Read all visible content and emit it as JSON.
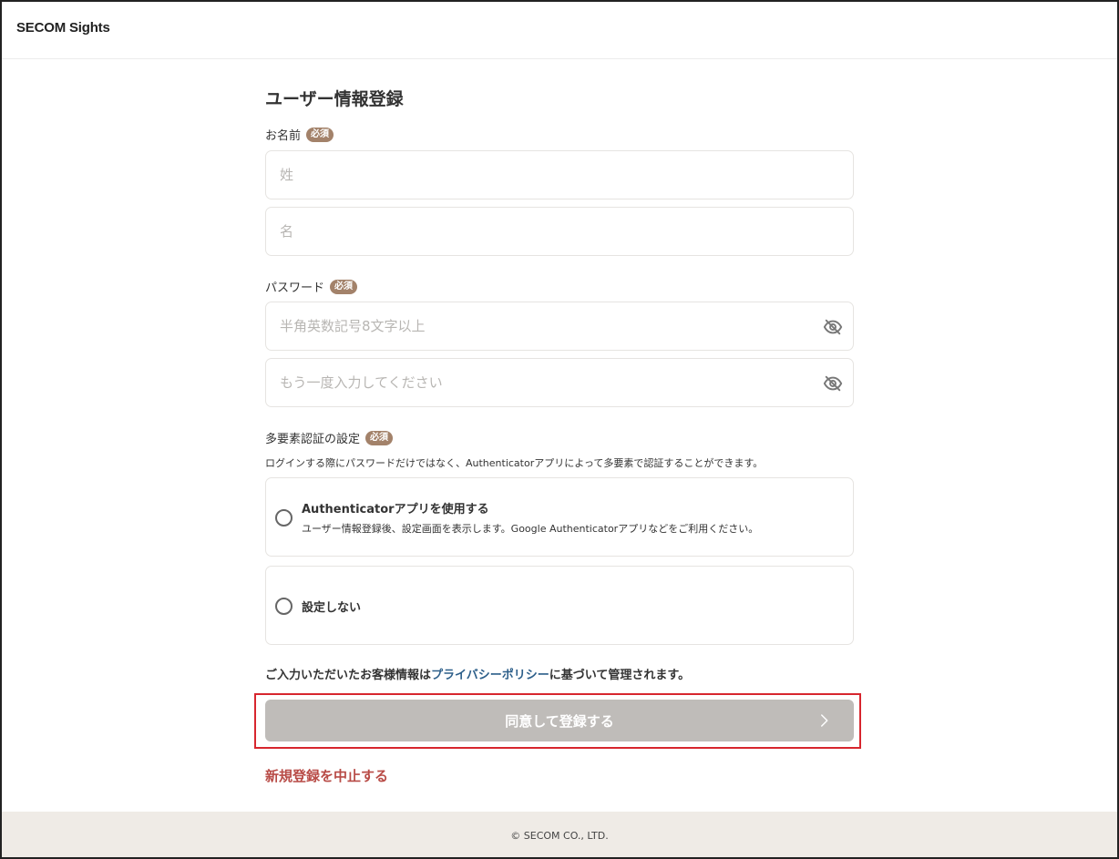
{
  "header": {
    "logo": "SECOM Sights"
  },
  "page": {
    "title": "ユーザー情報登録"
  },
  "required_badge": "必須",
  "name_section": {
    "label": "お名前",
    "last_name_placeholder": "姓",
    "first_name_placeholder": "名"
  },
  "password_section": {
    "label": "パスワード",
    "password_placeholder": "半角英数記号8文字以上",
    "confirm_placeholder": "もう一度入力してください",
    "visibility_icon": "eye-slash-icon"
  },
  "mfa_section": {
    "label": "多要素認証の設定",
    "description": "ログインする際にパスワードだけではなく、Authenticatorアプリによって多要素で認証することができます。",
    "options": [
      {
        "title": "Authenticatorアプリを使用する",
        "subtitle": "ユーザー情報登録後、設定画面を表示します。Google Authenticatorアプリなどをご利用ください。"
      },
      {
        "title": "設定しない"
      }
    ]
  },
  "policy": {
    "prefix": "ご入力いただいたお客様情報は",
    "link": "プライバシーポリシー",
    "suffix": "に基づいて管理されます。"
  },
  "actions": {
    "submit_label": "同意して登録する",
    "cancel_label": "新規登録を中止する"
  },
  "footer": {
    "copyright": "© SECOM CO., LTD."
  },
  "colors": {
    "badge": "#a3826a",
    "submit_disabled": "#bfbcb9",
    "cancel": "#b84b46",
    "link": "#2d5f8a",
    "highlight": "#d7262e",
    "footer_bg": "#efebe6"
  }
}
